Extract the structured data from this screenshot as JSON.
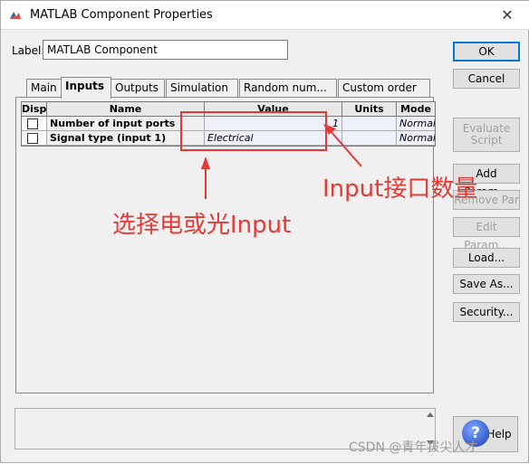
{
  "window": {
    "title": "MATLAB Component Properties",
    "close_glyph": "✕"
  },
  "label_field": {
    "caption": "Label:",
    "value": "MATLAB Component"
  },
  "buttons": {
    "ok": "OK",
    "cancel": "Cancel",
    "evaluate_script": "Evaluate Script",
    "add_param": "Add Param...",
    "remove_par": "Remove Par",
    "edit_param": "Edit Param...",
    "load": "Load...",
    "save_as": "Save As...",
    "security": "Security...",
    "help": "Help"
  },
  "tabs": [
    "Main",
    "Inputs",
    "Outputs",
    "Simulation",
    "Random num...",
    "Custom order"
  ],
  "active_tab": "Inputs",
  "grid": {
    "columns": [
      "Disp",
      "Name",
      "Value",
      "Units",
      "Mode"
    ],
    "rows": [
      {
        "disp": false,
        "name": "Number of input ports",
        "value": "1",
        "units": "",
        "mode": "Normal"
      },
      {
        "disp": false,
        "name": "Signal type (input 1)",
        "value": "Electrical",
        "units": "",
        "mode": "Normal"
      }
    ]
  },
  "annotations": {
    "ports": "Input接口数量",
    "signal": "选择电或光Input"
  },
  "watermark": "CSDN @青年拔尖人才",
  "colors": {
    "annotation": "#e53935",
    "default_button_border": "#0078d7"
  },
  "icons": {
    "app": "matlab-logo-icon",
    "help": "help-question-icon",
    "close": "close-icon"
  }
}
